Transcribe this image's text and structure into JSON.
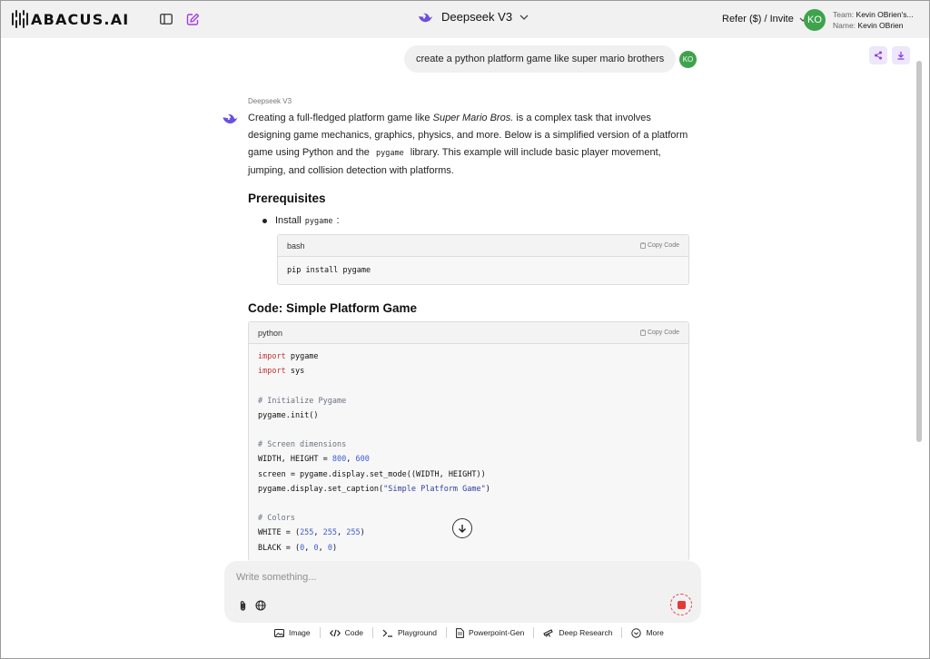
{
  "header": {
    "logo_text": "ABACUS.AI",
    "model": "Deepseek V3",
    "refer": "Refer ($) / Invite",
    "avatar_initials": "KO",
    "team_label": "Team:",
    "team_value": "Kevin OBrien's...",
    "name_label": "Name:",
    "name_value": "Kevin OBrien"
  },
  "chat": {
    "user_message": "create a python platform game like super mario brothers",
    "user_initials": "KO",
    "model_name": "Deepseek V3",
    "intro_part1": "Creating a full-fledged platform game like ",
    "intro_em": "Super Mario Bros.",
    "intro_part2": " is a complex task that involves designing game mechanics, graphics, physics, and more. Below is a simplified version of a platform game using Python and the ",
    "intro_code": "pygame",
    "intro_part3": " library. This example will include basic player movement, jumping, and collision detection with platforms.",
    "prereq_heading": "Prerequisites",
    "bullet_text": "Install",
    "bullet_code": "pygame",
    "bullet_colon": ":",
    "bash_block": {
      "lang": "bash",
      "copy": "Copy Code",
      "code": "pip install pygame"
    },
    "code_heading": "Code: Simple Platform Game",
    "python_block": {
      "lang": "python",
      "copy": "Copy Code",
      "lines": {
        "l1_kw": "import",
        "l1_rest": " pygame",
        "l2_kw": "import",
        "l2_rest": " sys",
        "l4": "# Initialize Pygame",
        "l5": "pygame.init()",
        "l7": "# Screen dimensions",
        "l8_a": "WIDTH, HEIGHT = ",
        "l8_n1": "800",
        "l8_b": ", ",
        "l8_n2": "600",
        "l9": "screen = pygame.display.set_mode((WIDTH, HEIGHT))",
        "l10_a": "pygame.display.set_caption(",
        "l10_s": "\"Simple Platform Game\"",
        "l10_b": ")",
        "l12": "# Colors",
        "l13_a": "WHITE = (",
        "l13_n1": "255",
        "l13_n2": "255",
        "l13_n3": "255",
        "l13_b": ")",
        "l14_a": "BLACK = (",
        "l14_n1": "0",
        "l14_n2": "0",
        "l14_n3": "0",
        "l14_b": ")",
        "sep": ", "
      }
    }
  },
  "composer": {
    "placeholder": "Write something..."
  },
  "tools": [
    "Image",
    "Code",
    "Playground",
    "Powerpoint-Gen",
    "Deep Research",
    "More"
  ]
}
